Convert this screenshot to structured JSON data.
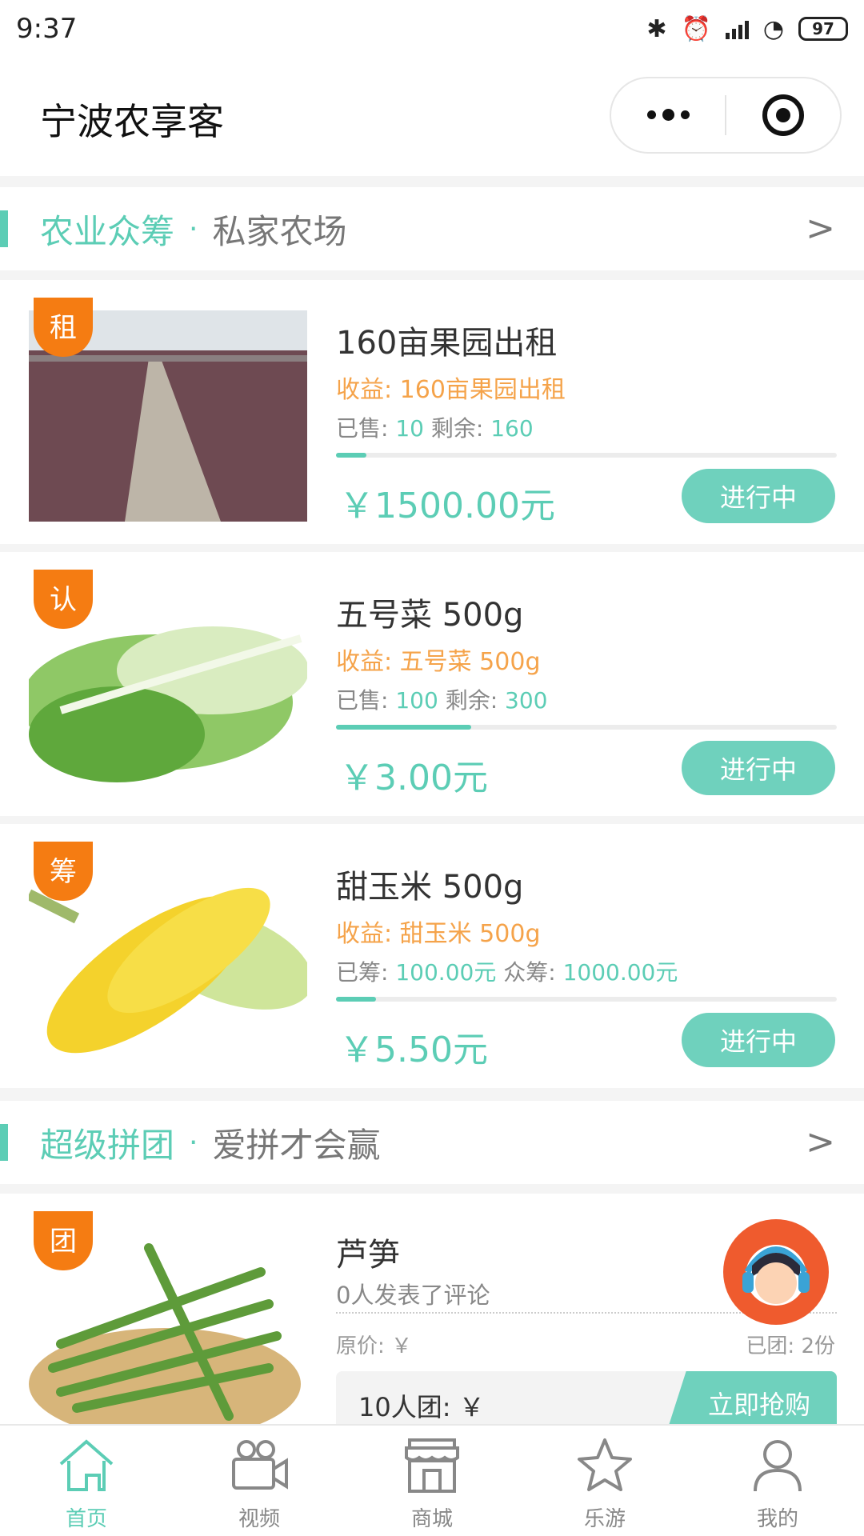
{
  "status_bar": {
    "time": "9:37",
    "battery": "97"
  },
  "header": {
    "title": "宁波农享客"
  },
  "sections": [
    {
      "title": "农业众筹",
      "dot": "·",
      "subtitle": "私家农场",
      "arrow": ">"
    },
    {
      "title": "超级拼团",
      "dot": "·",
      "subtitle": "爱拼才会赢",
      "arrow": ">"
    }
  ],
  "products": [
    {
      "tag": "租",
      "name": "160亩果园出租",
      "benefit": "收益: 160亩果园出租",
      "stat1_label": "已售: ",
      "stat1_value": "10",
      "stat2_label": " 剩余: ",
      "stat2_value": "160",
      "progress": 0.06,
      "price": "￥1500.00元",
      "status": "进行中"
    },
    {
      "tag": "认",
      "name": "五号菜 500g",
      "benefit": "收益:  五号菜 500g",
      "stat1_label": "已售: ",
      "stat1_value": "100",
      "stat2_label": " 剩余: ",
      "stat2_value": "300",
      "progress": 0.27,
      "price": "￥3.00元",
      "status": "进行中"
    },
    {
      "tag": "筹",
      "name": "甜玉米 500g",
      "benefit": "收益:  甜玉米 500g",
      "stat1_label": "已筹: ",
      "stat1_value": "100.00元",
      "stat2_label": " 众筹: ",
      "stat2_value": "1000.00元",
      "progress": 0.08,
      "price": "￥5.50元",
      "status": "进行中"
    }
  ],
  "group_buy": {
    "tag": "团",
    "name": "芦笋",
    "comments": "0人发表了评论",
    "original_price": "原价: ￥",
    "joined": "已团: 2份",
    "team": "10人团: ￥",
    "buy_label": "立即抢购"
  },
  "tabs": [
    {
      "label": "首页",
      "icon": "home-icon",
      "active": true
    },
    {
      "label": "视频",
      "icon": "video-camera-icon",
      "active": false
    },
    {
      "label": "商城",
      "icon": "store-icon",
      "active": false
    },
    {
      "label": "乐游",
      "icon": "star-icon",
      "active": false
    },
    {
      "label": "我的",
      "icon": "user-icon",
      "active": false
    }
  ],
  "colors": {
    "accent": "#5ccdb5",
    "tag": "#f57c12",
    "benefit": "#f5a34a",
    "button": "#6fd1bd",
    "support": "#ef5b2e"
  }
}
